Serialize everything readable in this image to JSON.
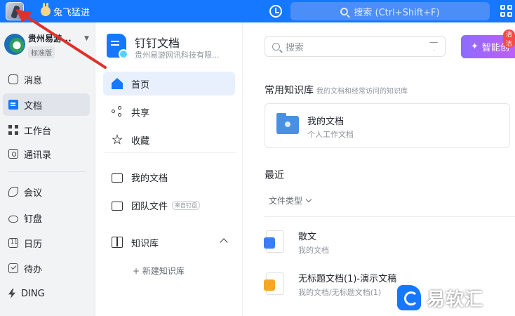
{
  "topbar": {
    "username": "兔飞猛进",
    "search_placeholder": "搜索 (Ctrl+Shift+F)"
  },
  "org": {
    "name": "贵州易游...",
    "badge": "标准版"
  },
  "leftnav": {
    "items": [
      {
        "label": "消息",
        "icon": "chat-icon"
      },
      {
        "label": "文档",
        "icon": "document-icon",
        "active": true
      },
      {
        "label": "工作台",
        "icon": "grid-icon"
      },
      {
        "label": "通讯录",
        "icon": "contacts-icon"
      },
      {
        "label": "会议",
        "icon": "phone-icon"
      },
      {
        "label": "钉盘",
        "icon": "cloud-icon"
      },
      {
        "label": "日历",
        "icon": "calendar-icon"
      },
      {
        "label": "待办",
        "icon": "todo-icon"
      },
      {
        "label": "DING",
        "icon": "ding-icon"
      }
    ]
  },
  "midnav": {
    "title": "钉钉文档",
    "subtitle": "贵州易游网讯科技有限...",
    "items": [
      {
        "label": "首页",
        "active": true
      },
      {
        "label": "共享"
      },
      {
        "label": "收藏"
      },
      {
        "label": "我的文档"
      },
      {
        "label": "团队文件",
        "tag": "来自钉盘"
      },
      {
        "label": "知识库"
      }
    ],
    "new_kb": "+ 新建知识库"
  },
  "main": {
    "search_placeholder": "搜索",
    "ai_button": "智能创",
    "ai_badge": "清洁",
    "kb_section_title": "常用知识库",
    "kb_section_sub": "我的文档和经常访问的知识库",
    "kb_card": {
      "name": "我的文档",
      "desc": "个人工作文档"
    },
    "recent_title": "最近",
    "filter_label": "文件类型",
    "files": [
      {
        "name": "散文",
        "path": "我的文档",
        "color": "#3c7cf6"
      },
      {
        "name": "无标题文档(1)-演示文稿",
        "path": "我的文档/无标题文档(1)",
        "color": "#f5a623"
      }
    ]
  },
  "watermark": {
    "text": "易软汇"
  }
}
